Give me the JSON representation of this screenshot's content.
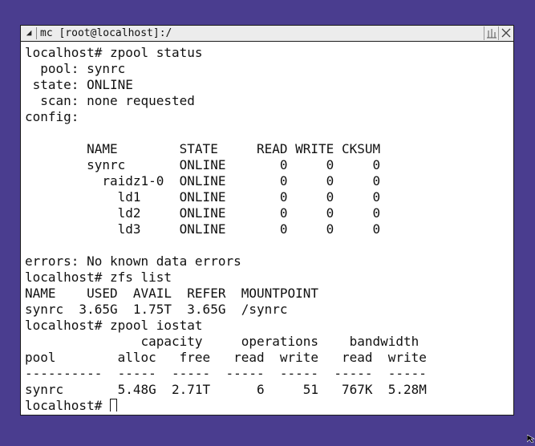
{
  "window": {
    "title": "mc [root@localhost]:/",
    "menu_glyph": "◢"
  },
  "terminal": {
    "lines": [
      "localhost# zpool status",
      "  pool: synrc",
      " state: ONLINE",
      "  scan: none requested",
      "config:",
      "",
      "        NAME        STATE     READ WRITE CKSUM",
      "        synrc       ONLINE       0     0     0",
      "          raidz1-0  ONLINE       0     0     0",
      "            ld1     ONLINE       0     0     0",
      "            ld2     ONLINE       0     0     0",
      "            ld3     ONLINE       0     0     0",
      "",
      "errors: No known data errors",
      "localhost# zfs list",
      "NAME    USED  AVAIL  REFER  MOUNTPOINT",
      "synrc  3.65G  1.75T  3.65G  /synrc",
      "localhost# zpool iostat",
      "               capacity     operations    bandwidth",
      "pool        alloc   free   read  write   read  write",
      "----------  -----  -----  -----  -----  -----  -----",
      "synrc       5.48G  2.71T      6     51   767K  5.28M"
    ],
    "prompt": "localhost# "
  }
}
